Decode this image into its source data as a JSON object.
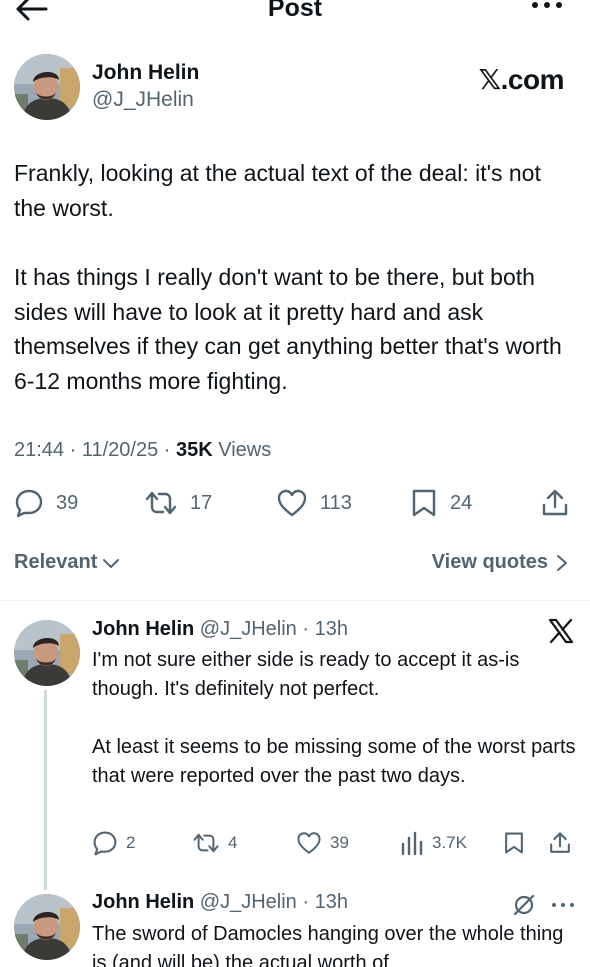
{
  "header": {
    "title": "Post",
    "back_icon": "arrow-left-icon",
    "more_icon": "more-horizontal-icon"
  },
  "main_post": {
    "author_name": "John Helin",
    "author_handle": "@J_JHelin",
    "source_badge": "𝕏.com",
    "paragraphs": [
      "Frankly, looking at the actual text of the deal: it's not the worst.",
      "It has things I really don't want to be there, but both sides will have to look at it pretty hard and ask themselves if they can get anything better that's worth 6-12 months more fighting."
    ],
    "time": "21:44 · 11/20/25 · ",
    "views_count": "35K",
    "views_label": " Views",
    "replies": "39",
    "reposts": "17",
    "likes": "113",
    "bookmarks": "24"
  },
  "filter": {
    "sort_label": "Relevant",
    "view_quotes_label": "View quotes"
  },
  "replies": [
    {
      "author_name": "John Helin",
      "author_handle": "@J_JHelin · 13h",
      "paragraphs": [
        "I'm not sure either side is ready to accept it as-is though. It's definitely not perfect.",
        "At least it seems to be missing some of the worst parts that were reported over the past two days."
      ],
      "replies": "2",
      "reposts": "4",
      "likes": "39",
      "views": "3.7K"
    },
    {
      "author_name": "John Helin",
      "author_handle": "@J_JHelin · 13h",
      "paragraphs": [
        "The sword of Damocles hanging over the whole thing is (and will be) the actual worth of"
      ]
    }
  ]
}
